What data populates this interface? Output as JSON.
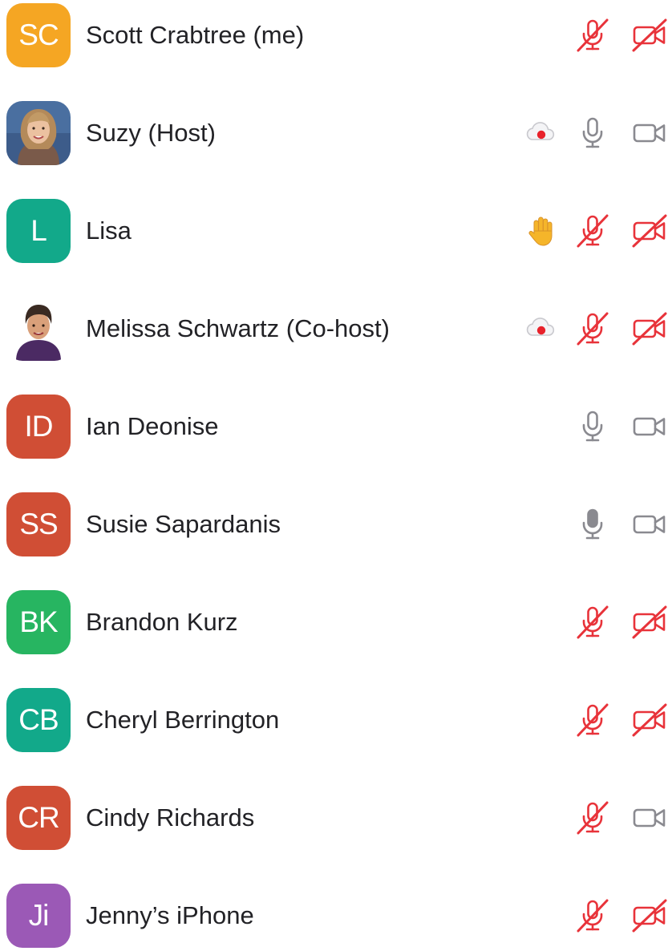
{
  "participants": [
    {
      "initials": "SC",
      "name": "Scott Crabtree (me)",
      "avatar_color": "#F5A623",
      "photo": false,
      "extra": null,
      "mic": "muted",
      "camera": "off"
    },
    {
      "initials": "",
      "name": "Suzy (Host)",
      "avatar_color": "#4A6FA0",
      "photo": true,
      "extra": "recording",
      "mic": "on",
      "camera": "on"
    },
    {
      "initials": "L",
      "name": "Lisa",
      "avatar_color": "#12A98A",
      "photo": false,
      "extra": "raised-hand",
      "mic": "muted",
      "camera": "off"
    },
    {
      "initials": "",
      "name": "Melissa Schwartz (Co-host)",
      "avatar_color": "#5A2E6E",
      "photo": true,
      "extra": "recording",
      "mic": "muted",
      "camera": "off"
    },
    {
      "initials": "ID",
      "name": "Ian Deonise",
      "avatar_color": "#D04E35",
      "photo": false,
      "extra": null,
      "mic": "on",
      "camera": "on"
    },
    {
      "initials": "SS",
      "name": "Susie Sapardanis",
      "avatar_color": "#D04E35",
      "photo": false,
      "extra": null,
      "mic": "speaking",
      "camera": "on"
    },
    {
      "initials": "BK",
      "name": "Brandon Kurz",
      "avatar_color": "#27B561",
      "photo": false,
      "extra": null,
      "mic": "muted",
      "camera": "off"
    },
    {
      "initials": "CB",
      "name": "Cheryl Berrington",
      "avatar_color": "#12A98A",
      "photo": false,
      "extra": null,
      "mic": "muted",
      "camera": "off"
    },
    {
      "initials": "CR",
      "name": "Cindy Richards",
      "avatar_color": "#D04E35",
      "photo": false,
      "extra": null,
      "mic": "muted",
      "camera": "on"
    },
    {
      "initials": "Ji",
      "name": "Jenny’s iPhone",
      "avatar_color": "#9B59B6",
      "photo": false,
      "extra": null,
      "mic": "muted",
      "camera": "off"
    }
  ],
  "colors": {
    "muted_red": "#E8333A",
    "icon_gray": "#8A8A90",
    "text": "#222226",
    "hand": "#F5B52A"
  },
  "icons": {
    "mic_on": "microphone-icon",
    "mic_muted": "microphone-muted-icon",
    "camera_on": "video-camera-icon",
    "camera_off": "video-camera-off-icon",
    "recording": "cloud-recording-icon",
    "raised_hand": "raised-hand-icon"
  }
}
